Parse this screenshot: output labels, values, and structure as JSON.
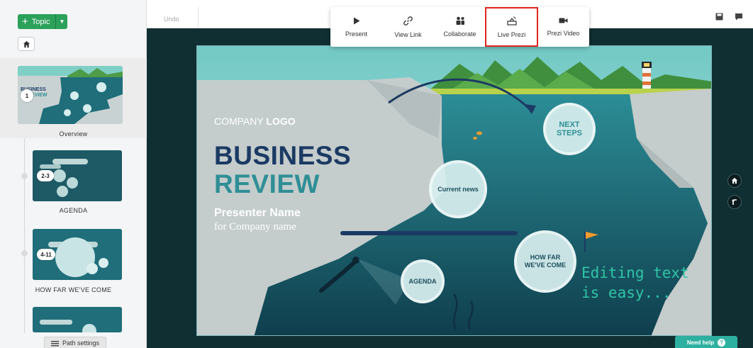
{
  "sidebar": {
    "topic_label": "Topic",
    "items": [
      {
        "badge": "1",
        "label": "Overview"
      },
      {
        "badge": "2-3",
        "label": "AGENDA"
      },
      {
        "badge": "4-11",
        "label": "HOW FAR WE'VE COME"
      },
      {
        "badge": "",
        "label": ""
      }
    ],
    "overview_thumb": {
      "line1": "BUSINESS",
      "line2": "REVIEW"
    },
    "path_settings_label": "Path settings"
  },
  "topbar": {
    "undo_label": "Undo"
  },
  "toolbar": {
    "items": [
      {
        "label": "Present",
        "icon": "play-icon"
      },
      {
        "label": "View Link",
        "icon": "link-icon"
      },
      {
        "label": "Collaborate",
        "icon": "people-icon"
      },
      {
        "label": "Live Prezi",
        "icon": "live-broadcast-icon",
        "highlighted": true
      },
      {
        "label": "Prezi Video",
        "icon": "video-camera-icon"
      }
    ],
    "highlight_color": "#e0251f"
  },
  "slide": {
    "company_prefix": "COMPANY",
    "company_suffix": "LOGO",
    "title_line1": "BUSINESS",
    "title_line2": "REVIEW",
    "presenter": "Presenter Name",
    "company_name": "for Company name",
    "circles": {
      "next_steps_l1": "NEXT",
      "next_steps_l2": "STEPS",
      "current_news": "Current news",
      "how_far_l1": "HOW FAR",
      "how_far_l2": "WE'VE COME",
      "agenda": "AGENDA"
    },
    "annotation_l1": "Editing text",
    "annotation_l2": "is easy...",
    "colors": {
      "title_dark": "#1b3a63",
      "title_teal": "#2f8f95",
      "annotation": "#2fc4a6",
      "water": "#1f6e7a",
      "rock": "#c4cccc"
    }
  },
  "help": {
    "label": "Need help"
  }
}
